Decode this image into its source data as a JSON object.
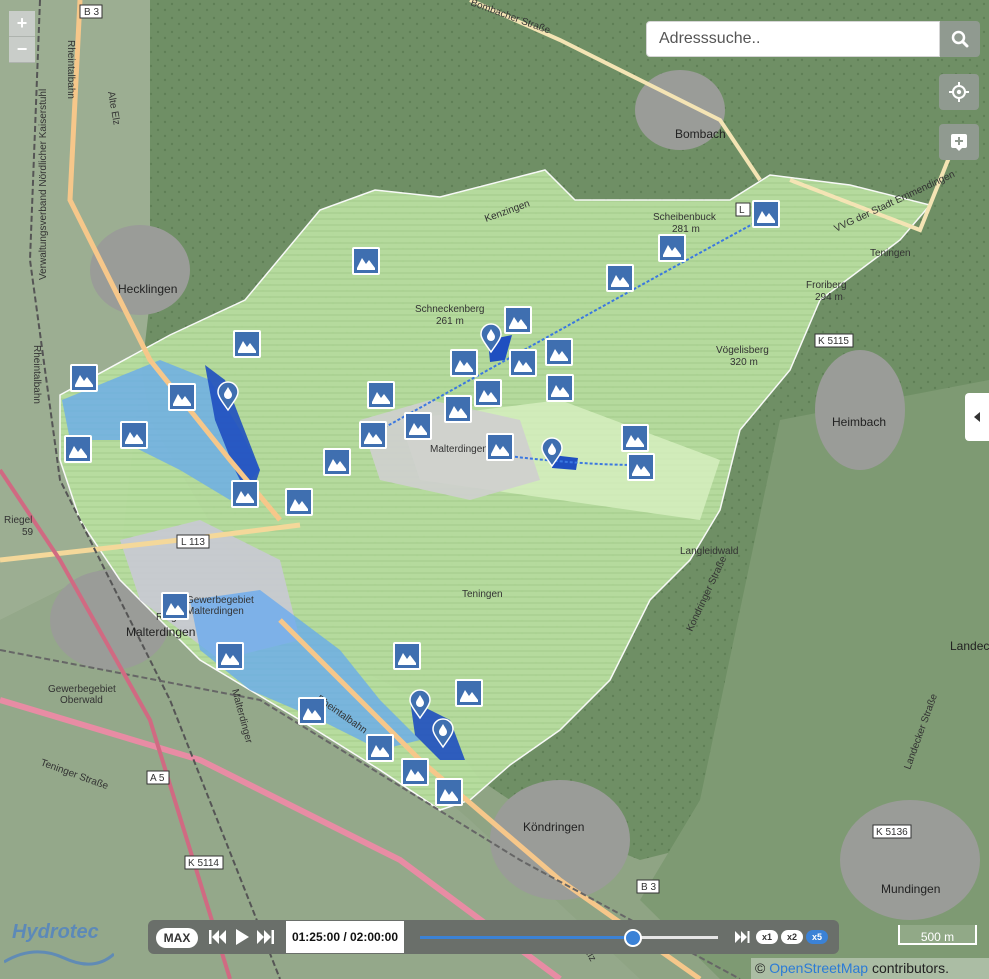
{
  "controls": {
    "zoom_in": "+",
    "zoom_out": "−",
    "search_placeholder": "Adresssuche..",
    "max_label": "MAX",
    "time_readout": "01:25:00 / 02:00:00",
    "progress_fraction": 0.71,
    "speeds": [
      "x1",
      "x2",
      "x5"
    ],
    "active_speed": "x5",
    "scale_label": "500 m",
    "attribution_prefix": "©",
    "attribution_link": "OpenStreetMap",
    "attribution_suffix": "contributors."
  },
  "map": {
    "places": [
      {
        "label": "Bombach",
        "bold": true
      },
      {
        "label": "Hecklingen",
        "bold": true
      },
      {
        "label": "Heimbach",
        "bold": true
      },
      {
        "label": "Köndringen",
        "bold": true
      },
      {
        "label": "Mundingen",
        "bold": true
      },
      {
        "label": "Riegel",
        "bold": false
      },
      {
        "label": "Malterdingen",
        "bold": true
      },
      {
        "label": "Malterdingen",
        "bold": false
      },
      {
        "label": "Landec",
        "bold": true
      },
      {
        "label": "Gewerbegebiet",
        "bold": false
      },
      {
        "label": "Oberwald",
        "bold": false
      },
      {
        "label": "Gewerbegebiet",
        "bold": false
      },
      {
        "label": "Malterdingen",
        "bold": false
      },
      {
        "label": "Schneckenberg",
        "bold": false
      },
      {
        "label": "261 m",
        "bold": false
      },
      {
        "label": "Scheibenbuck",
        "bold": false
      },
      {
        "label": "281 m",
        "bold": false
      },
      {
        "label": "Vögelisberg",
        "bold": false
      },
      {
        "label": "320 m",
        "bold": false
      },
      {
        "label": "Froriberg",
        "bold": false
      },
      {
        "label": "294 m",
        "bold": false
      },
      {
        "label": "Langleidwald",
        "bold": false
      },
      {
        "label": "Teningen",
        "bold": false
      },
      {
        "label": "Teningen",
        "bold": false
      },
      {
        "label": "Teninger Straße",
        "bold": false
      },
      {
        "label": "Bombacher Straße",
        "bold": false
      },
      {
        "label": "Kenzingen",
        "bold": false
      },
      {
        "label": "Rheintalbahn",
        "bold": false
      },
      {
        "label": "Rheintalbahn",
        "bold": false
      },
      {
        "label": "Rheintalbahn",
        "bold": false
      },
      {
        "label": "Alte Elz",
        "bold": false
      },
      {
        "label": "Elz",
        "bold": false
      },
      {
        "label": "Verwaltungsverband Nördlicher Kaiserstuhl",
        "bold": false
      },
      {
        "label": "Kondringer Straße",
        "bold": false
      },
      {
        "label": "Landecker Straße",
        "bold": false
      },
      {
        "label": "Malterdinger",
        "bold": false
      },
      {
        "label": "VVG der Stadt Emmendingen",
        "bold": false
      },
      {
        "label": "Riegel",
        "bold": false
      },
      {
        "label": "59",
        "bold": false
      }
    ],
    "road_shields": [
      "B 3",
      "L 113",
      "K 5115",
      "A 5",
      "K 5114",
      "K 5136",
      "B 3",
      "L"
    ],
    "station_icon": "chart-station-icon",
    "gauge_icon": "water-drop-pin-icon",
    "station_count": 33,
    "gauge_count": 5,
    "logo_text": "Hydrotec"
  },
  "colors": {
    "forest": "#6f8f65",
    "catchment": "#c8ecb0",
    "flood_light": "#64a8f0",
    "flood_dark": "#1f4fc0",
    "marker": "#3f6fb0",
    "accent": "#3b82d6"
  }
}
